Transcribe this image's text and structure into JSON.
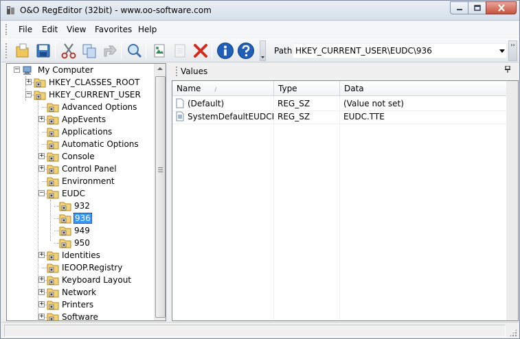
{
  "window": {
    "title": "O&O RegEditor (32bit) - www.oo-software.com"
  },
  "menu": [
    {
      "label": "File",
      "name": "menu-file"
    },
    {
      "label": "Edit",
      "name": "menu-edit"
    },
    {
      "label": "View",
      "name": "menu-view"
    },
    {
      "label": "Favorites",
      "name": "menu-favorites"
    },
    {
      "label": "Help",
      "name": "menu-help"
    }
  ],
  "toolbar": {
    "buttons": [
      "new-folder-icon",
      "save-icon",
      "cut-icon",
      "copy-icon",
      "paste-icon",
      "find-icon",
      "export-icon",
      "blank-page-icon",
      "delete-icon",
      "info-icon",
      "help-icon"
    ],
    "path_label": "Path",
    "path_value": "HKEY_CURRENT_USER\\EUDC\\936"
  },
  "tree": {
    "root": "My Computer",
    "items": [
      {
        "label": "HKEY_CLASSES_ROOT",
        "level": 1,
        "expander": "+"
      },
      {
        "label": "HKEY_CURRENT_USER",
        "level": 1,
        "expander": "-"
      },
      {
        "label": "Advanced Options",
        "level": 2,
        "expander": ""
      },
      {
        "label": "AppEvents",
        "level": 2,
        "expander": "+"
      },
      {
        "label": "Applications",
        "level": 2,
        "expander": ""
      },
      {
        "label": "Automatic Options",
        "level": 2,
        "expander": ""
      },
      {
        "label": "Console",
        "level": 2,
        "expander": "+"
      },
      {
        "label": "Control Panel",
        "level": 2,
        "expander": "+"
      },
      {
        "label": "Environment",
        "level": 2,
        "expander": ""
      },
      {
        "label": "EUDC",
        "level": 2,
        "expander": "-"
      },
      {
        "label": "932",
        "level": 3,
        "expander": ""
      },
      {
        "label": "936",
        "level": 3,
        "expander": "",
        "selected": true
      },
      {
        "label": "949",
        "level": 3,
        "expander": ""
      },
      {
        "label": "950",
        "level": 3,
        "expander": ""
      },
      {
        "label": "Identities",
        "level": 2,
        "expander": "+"
      },
      {
        "label": "IEOOP.Registry",
        "level": 2,
        "expander": ""
      },
      {
        "label": "Keyboard Layout",
        "level": 2,
        "expander": "+"
      },
      {
        "label": "Network",
        "level": 2,
        "expander": "+"
      },
      {
        "label": "Printers",
        "level": 2,
        "expander": "+"
      },
      {
        "label": "Software",
        "level": 2,
        "expander": "+"
      }
    ]
  },
  "values_panel": {
    "title": "Values",
    "pin": "↑",
    "columns": [
      "Name",
      "Type",
      "Data"
    ],
    "sort_indicator": "/",
    "rows": [
      {
        "name": "(Default)",
        "type": "REG_SZ",
        "data": "(Value not set)"
      },
      {
        "name": "SystemDefaultEUDCF...",
        "type": "REG_SZ",
        "data": "EUDC.TTE"
      }
    ]
  },
  "colors": {
    "selection": "#3399ff",
    "folder": "#f3d37a",
    "delete_red": "#d42a1e",
    "info_blue": "#1f5fb8"
  }
}
